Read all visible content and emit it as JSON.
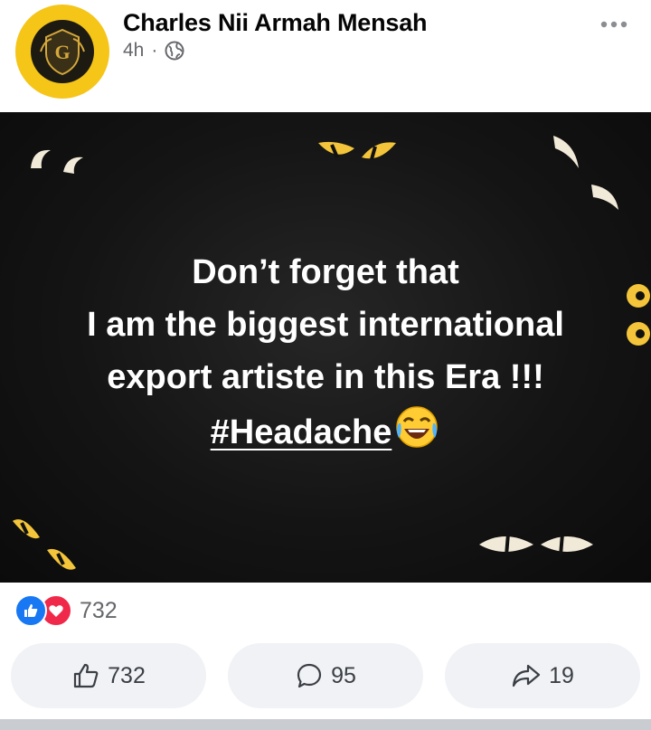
{
  "post": {
    "author": "Charles Nii Armah Mensah",
    "time": "4h",
    "separator": "·",
    "privacy_icon": "globe-icon",
    "more_icon": "more-options-icon",
    "image_text": {
      "line1": "Don’t forget that",
      "line2": "I am the biggest international",
      "line3": "export artiste in this Era !!!",
      "hashtag": "#Headache",
      "emoji": "face-with-tears-of-joy-emoji"
    },
    "reactions": {
      "types": [
        "like",
        "love"
      ],
      "count": "732"
    },
    "actions": {
      "like_count": "732",
      "comment_count": "95",
      "share_count": "19"
    }
  },
  "colors": {
    "like_blue": "#1877f2",
    "love_red": "#f02849",
    "avatar_gold": "#f5c518",
    "button_bg": "#f0f2f5"
  }
}
